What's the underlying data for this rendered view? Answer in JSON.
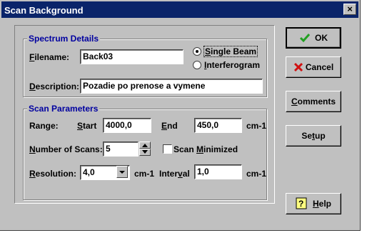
{
  "window": {
    "title": "Scan Background",
    "close_glyph": "×"
  },
  "spectrum": {
    "title": "Spectrum Details",
    "filename_label_u": "F",
    "filename_label_rest": "ilename:",
    "filename_value": "Back03",
    "description_label_u": "D",
    "description_label_rest": "escription:",
    "description_value": "Pozadie po prenose a vymene",
    "beam_options": [
      {
        "u": "S",
        "rest": "ingle Beam",
        "selected": true
      },
      {
        "u": "I",
        "rest": "nterferogram",
        "selected": false
      }
    ]
  },
  "scan": {
    "title": "Scan Parameters",
    "range_label": "Range:",
    "start_label_u": "S",
    "start_label_rest": "tart",
    "start_value": "4000,0",
    "end_label_u": "E",
    "end_label_rest": "nd",
    "end_value": "450,0",
    "unit": "cm-1",
    "num_scans_label_u": "N",
    "num_scans_label_rest": "umber of Scans:",
    "num_scans_value": "5",
    "scan_minimized_pre": "Scan ",
    "scan_minimized_u": "M",
    "scan_minimized_rest": "inimized",
    "scan_minimized_checked": false,
    "resolution_label_u": "R",
    "resolution_label_rest": "esolution:",
    "resolution_value": "4,0",
    "interval_label_pre": "Inter",
    "interval_label_u": "v",
    "interval_label_rest": "al",
    "interval_value": "1,0"
  },
  "buttons": {
    "ok": "OK",
    "cancel": "Cancel",
    "comments_u": "C",
    "comments_rest": "omments",
    "setup_pre": "Se",
    "setup_u": "t",
    "setup_rest": "up",
    "help_u": "H",
    "help_rest": "elp"
  },
  "colors": {
    "titlebar": "#0a246a",
    "group_title": "#0000a0",
    "face": "#c0c0c0"
  },
  "icons": {
    "ok": "check-icon",
    "cancel": "x-icon",
    "help": "help-icon"
  }
}
